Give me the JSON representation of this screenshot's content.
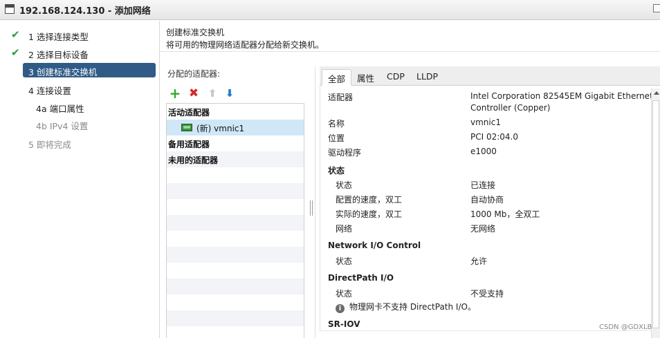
{
  "window": {
    "title": "192.168.124.130 - 添加网络"
  },
  "steps": [
    {
      "num": "1",
      "label": "1  选择连接类型",
      "state": "done"
    },
    {
      "num": "2",
      "label": "2  选择目标设备",
      "state": "done"
    },
    {
      "num": "3",
      "label": "3  创建标准交换机",
      "state": "active"
    },
    {
      "num": "4",
      "label": "4  连接设置",
      "state": "pending"
    },
    {
      "num": "4a",
      "label": "4a  端口属性",
      "state": "sub"
    },
    {
      "num": "4b",
      "label": "4b  IPv4 设置",
      "state": "sub-disabled"
    },
    {
      "num": "5",
      "label": "5  即将完成",
      "state": "disabled"
    }
  ],
  "header": {
    "title": "创建标准交换机",
    "subtitle": "将可用的物理网络适配器分配给新交换机。"
  },
  "adapters": {
    "label": "分配的适配器:",
    "toolbar": {
      "add_icon": "plus-icon",
      "remove_icon": "x-icon",
      "up_icon": "arrow-up-icon",
      "down_icon": "arrow-down-icon"
    },
    "groups": [
      {
        "name": "活动适配器",
        "items": [
          {
            "label": "(新) vmnic1",
            "selected": true
          }
        ]
      },
      {
        "name": "备用适配器",
        "items": []
      },
      {
        "name": "未用的适配器",
        "items": []
      }
    ]
  },
  "tabs": [
    "全部",
    "属性",
    "CDP",
    "LLDP"
  ],
  "details": {
    "adapter_k": "适配器",
    "adapter_v1": "Intel Corporation 82545EM Gigabit Ethernet",
    "adapter_v2": "Controller (Copper)",
    "name_k": "名称",
    "name_v": "vmnic1",
    "location_k": "位置",
    "location_v": "PCI 02:04.0",
    "driver_k": "驱动程序",
    "driver_v": "e1000",
    "status_section": "状态",
    "status_k": "状态",
    "status_v": "已连接",
    "cfg_speed_k": "配置的速度，双工",
    "cfg_speed_v": "自动协商",
    "act_speed_k": "实际的速度，双工",
    "act_speed_v": "1000 Mb，全双工",
    "network_k": "网络",
    "network_v": "无网络",
    "nioc_section": "Network I/O Control",
    "nioc_status_k": "状态",
    "nioc_status_v": "允许",
    "dp_section": "DirectPath I/O",
    "dp_status_k": "状态",
    "dp_status_v": "不受支持",
    "dp_note": "物理网卡不支持 DirectPath I/O。",
    "sriov_section": "SR-IOV"
  },
  "watermark": "CSDN @GDXLB",
  "colors": {
    "active_step": "#2f5b86",
    "selected_row": "#cfe7f7",
    "check": "#2f9b36"
  }
}
